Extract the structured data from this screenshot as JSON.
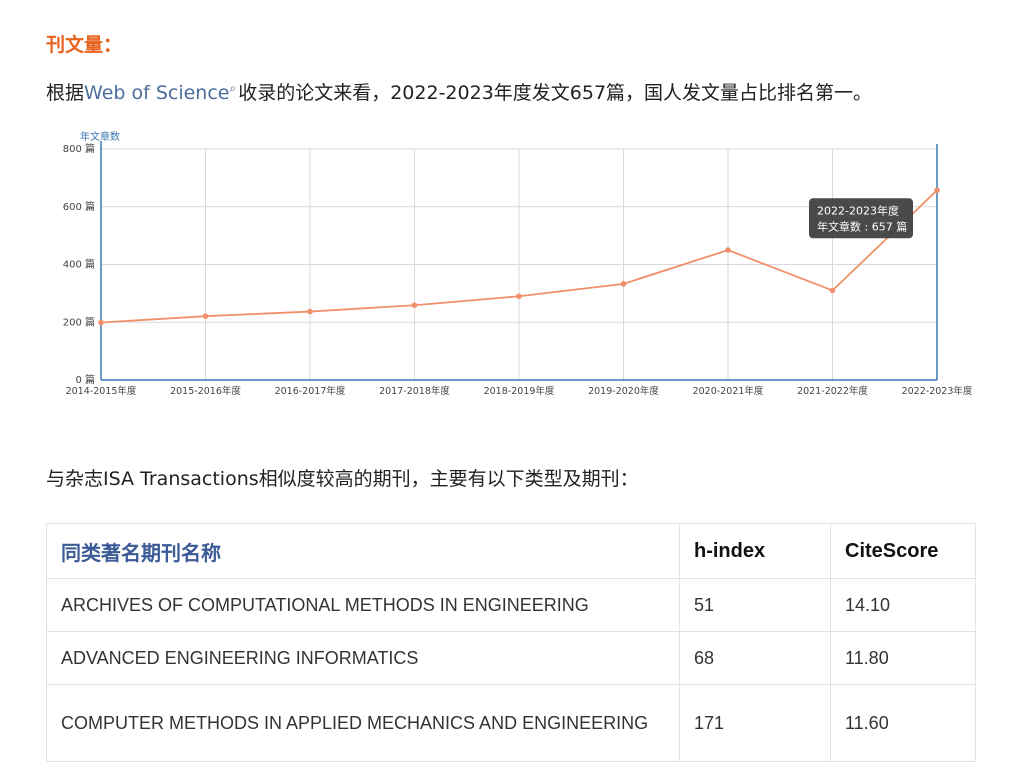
{
  "section_title": "刊文量：",
  "intro": {
    "prefix": "根据",
    "link": "Web of Science",
    "suffix": "收录的论文来看，2022-2023年度发文657篇，国人发文量占比排名第一。"
  },
  "chart_data": {
    "type": "line",
    "ylabel": "年文章数",
    "categories": [
      "2014-2015年度",
      "2015-2016年度",
      "2016-2017年度",
      "2017-2018年度",
      "2018-2019年度",
      "2019-2020年度",
      "2020-2021年度",
      "2021-2022年度",
      "2022-2023年度"
    ],
    "series": [
      {
        "values": [
          199,
          221,
          237,
          259,
          290,
          333,
          450,
          310,
          657
        ]
      }
    ],
    "ylim": [
      0,
      800
    ],
    "yticks": [
      "0 篇",
      "200 篇",
      "400 篇",
      "600 篇",
      "800 篇"
    ],
    "grid": true,
    "line_color": "#f0906a",
    "tooltip": {
      "title": "2022-2023年度",
      "text": "年文章数 : 657 篇"
    }
  },
  "sub_intro": "与杂志ISA Transactions相似度较高的期刊，主要有以下类型及期刊：",
  "table": {
    "headers": [
      "同类著名期刊名称",
      "h-index",
      "CiteScore"
    ],
    "rows": [
      [
        "ARCHIVES OF COMPUTATIONAL METHODS IN ENGINEERING",
        "51",
        "14.10"
      ],
      [
        "ADVANCED ENGINEERING INFORMATICS",
        "68",
        "11.80"
      ],
      [
        "COMPUTER METHODS IN APPLIED MECHANICS AND ENGINEERING",
        "171",
        "11.60"
      ]
    ]
  }
}
